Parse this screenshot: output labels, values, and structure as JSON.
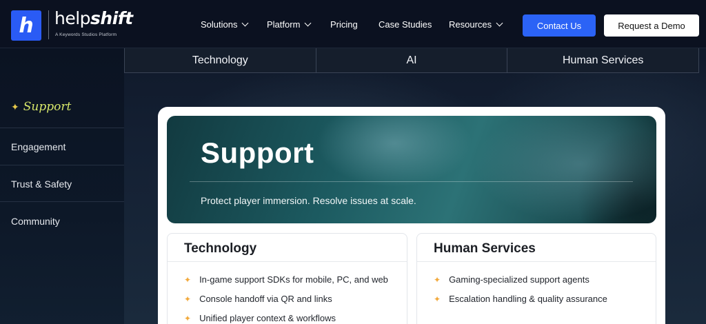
{
  "brand": {
    "logo_letter": "h",
    "wordmark_light": "help",
    "wordmark_bold": "shift",
    "tagline": "A Keywords Studios Platform"
  },
  "nav": {
    "items": [
      {
        "label": "Solutions",
        "has_dropdown": true
      },
      {
        "label": "Platform",
        "has_dropdown": true
      },
      {
        "label": "Pricing",
        "has_dropdown": false
      },
      {
        "label": "Case Studies",
        "has_dropdown": false
      },
      {
        "label": "Resources",
        "has_dropdown": true
      }
    ],
    "contact_label": "Contact Us",
    "demo_label": "Request a Demo"
  },
  "tabs": [
    "Technology",
    "AI",
    "Human Services"
  ],
  "sidebar": {
    "active_marker": "✦",
    "items": [
      "Support",
      "Engagement",
      "Trust & Safety",
      "Community"
    ]
  },
  "hero": {
    "title": "Support",
    "subtitle": "Protect player immersion. Resolve issues at scale."
  },
  "cards": [
    {
      "title": "Technology",
      "bullets": [
        "In-game support SDKs for mobile, PC, and web",
        "Console handoff via QR and links",
        "Unified player context & workflows"
      ]
    },
    {
      "title": "Human Services",
      "bullets": [
        "Gaming-specialized support agents",
        "Escalation handling & quality assurance"
      ]
    }
  ],
  "colors": {
    "primary_blue": "#2b63f6",
    "accent_yellow": "#d8e86a",
    "bullet_orange": "#f2a93b"
  }
}
